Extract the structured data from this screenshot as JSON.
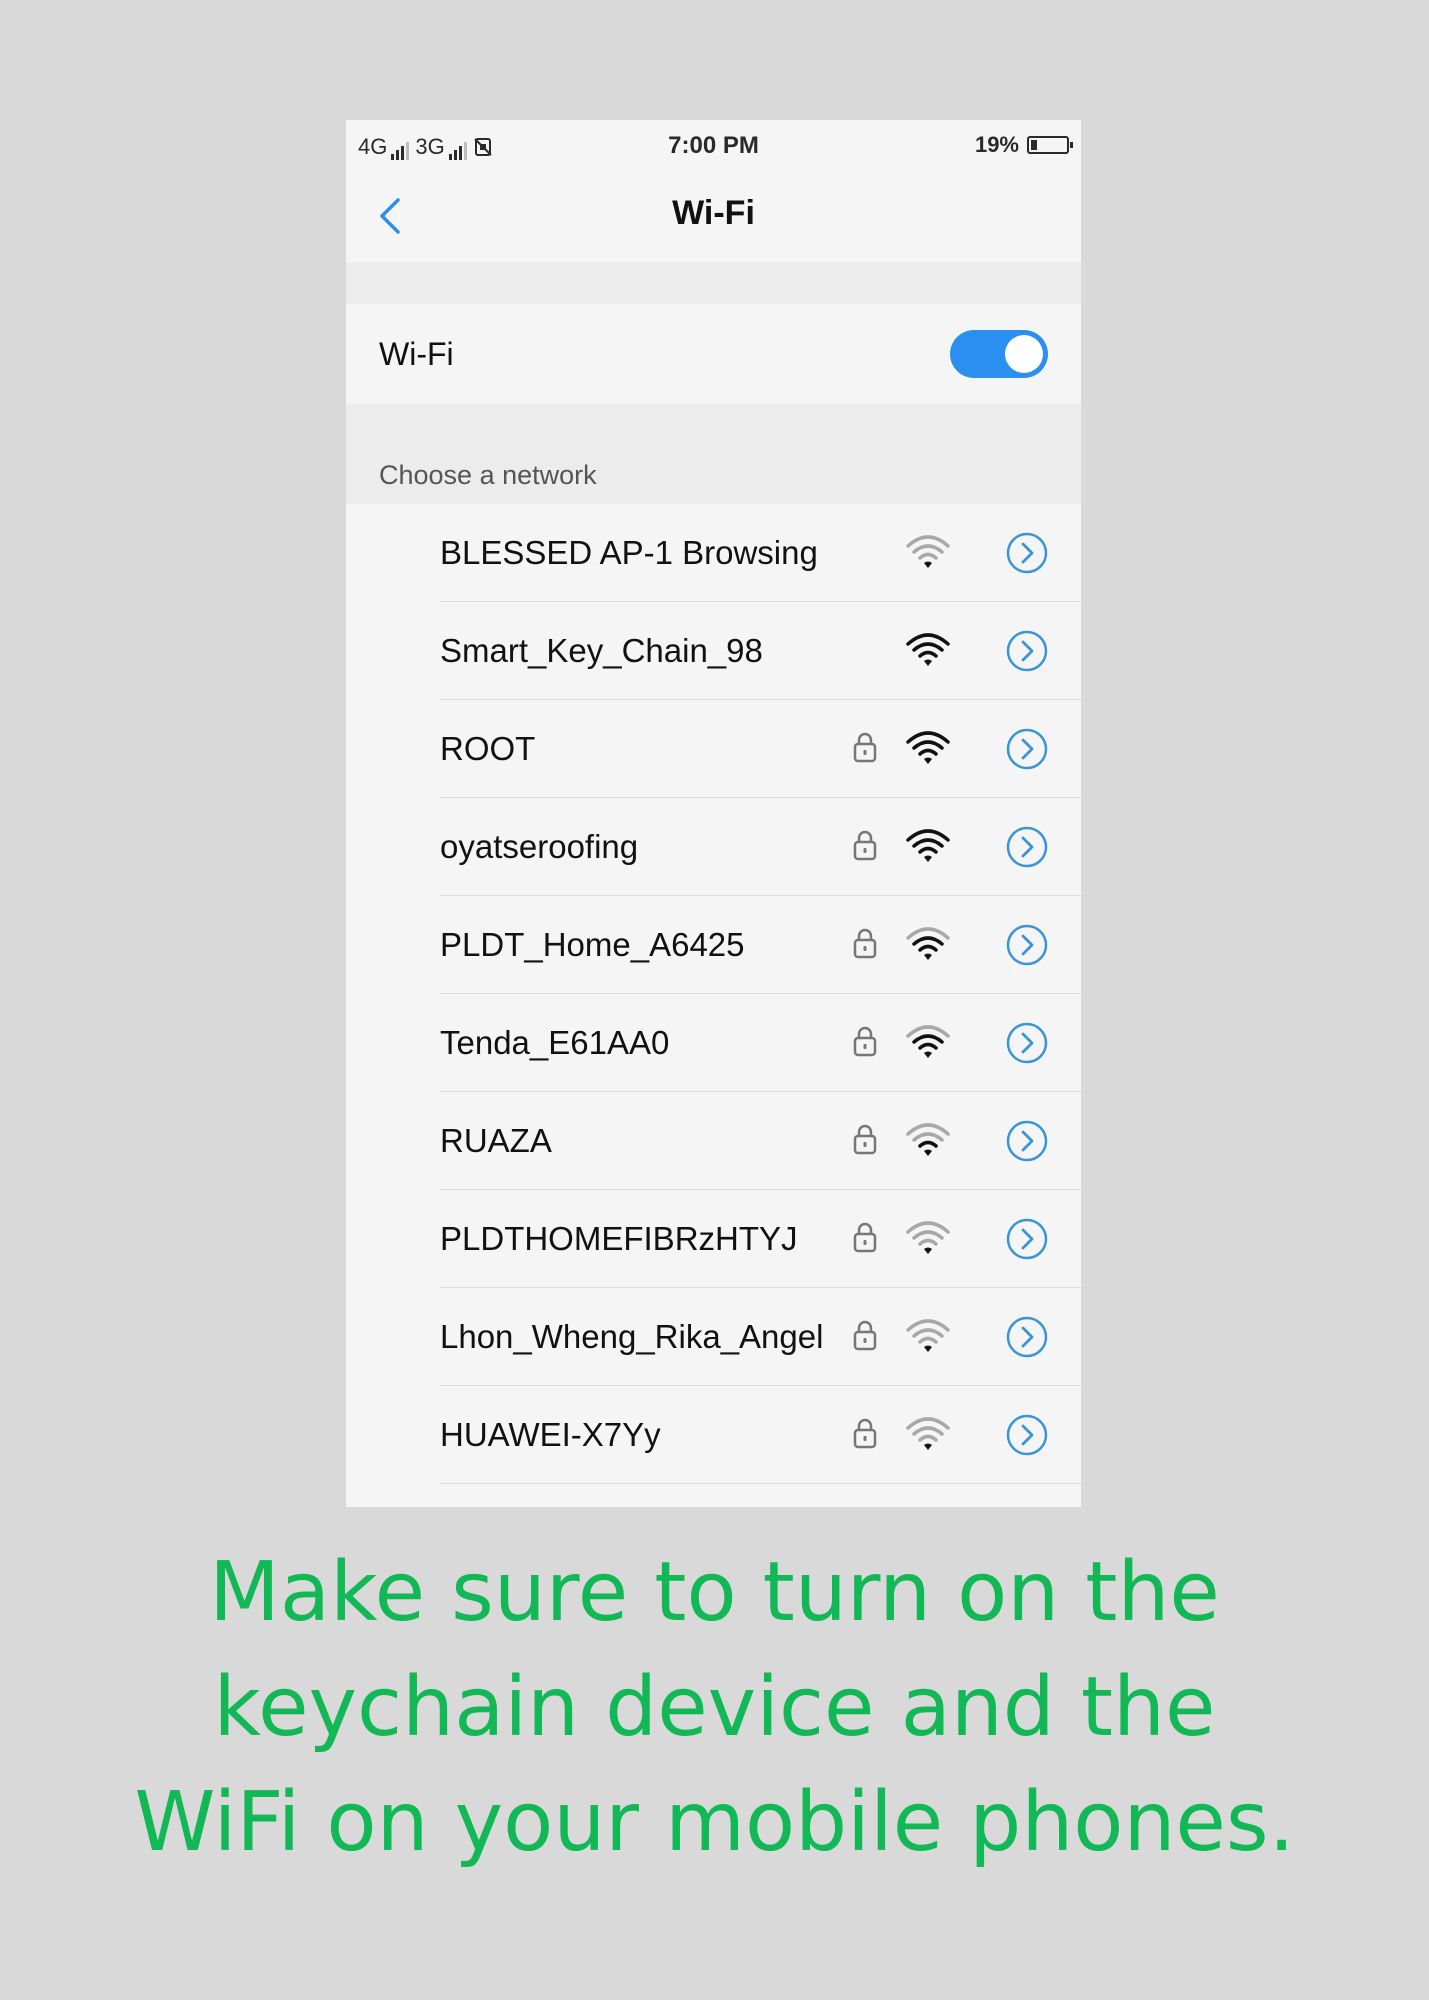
{
  "status_bar": {
    "sim1": "4G",
    "sim2": "3G",
    "time": "7:00 PM",
    "battery_text": "19%",
    "battery_level": 0.19
  },
  "header": {
    "back_icon": "chevron-left-icon",
    "title": "Wi-Fi"
  },
  "wifi_toggle": {
    "label": "Wi-Fi",
    "on": true
  },
  "section_label": "Choose a network",
  "networks": [
    {
      "name": "BLESSED AP-1 Browsing",
      "secured": false,
      "signal": 1
    },
    {
      "name": "Smart_Key_Chain_98",
      "secured": false,
      "signal": 4
    },
    {
      "name": "ROOT",
      "secured": true,
      "signal": 4
    },
    {
      "name": "oyatseroofing",
      "secured": true,
      "signal": 4
    },
    {
      "name": "PLDT_Home_A6425",
      "secured": true,
      "signal": 3
    },
    {
      "name": "Tenda_E61AA0",
      "secured": true,
      "signal": 3
    },
    {
      "name": "RUAZA",
      "secured": true,
      "signal": 2
    },
    {
      "name": "PLDTHOMEFIBRzHTYJ",
      "secured": true,
      "signal": 1
    },
    {
      "name": "Lhon_Wheng_Rika_Angel",
      "secured": true,
      "signal": 1
    },
    {
      "name": "HUAWEI-X7Yy",
      "secured": true,
      "signal": 1
    }
  ],
  "colors": {
    "accent": "#2b8ff0",
    "info_icon": "#3a95d8",
    "caption": "#12b856",
    "background": "#d9d9d9"
  },
  "caption": {
    "line1": "Make sure to turn on the",
    "line2": "keychain device and the",
    "line3": "WiFi on your mobile phones."
  }
}
